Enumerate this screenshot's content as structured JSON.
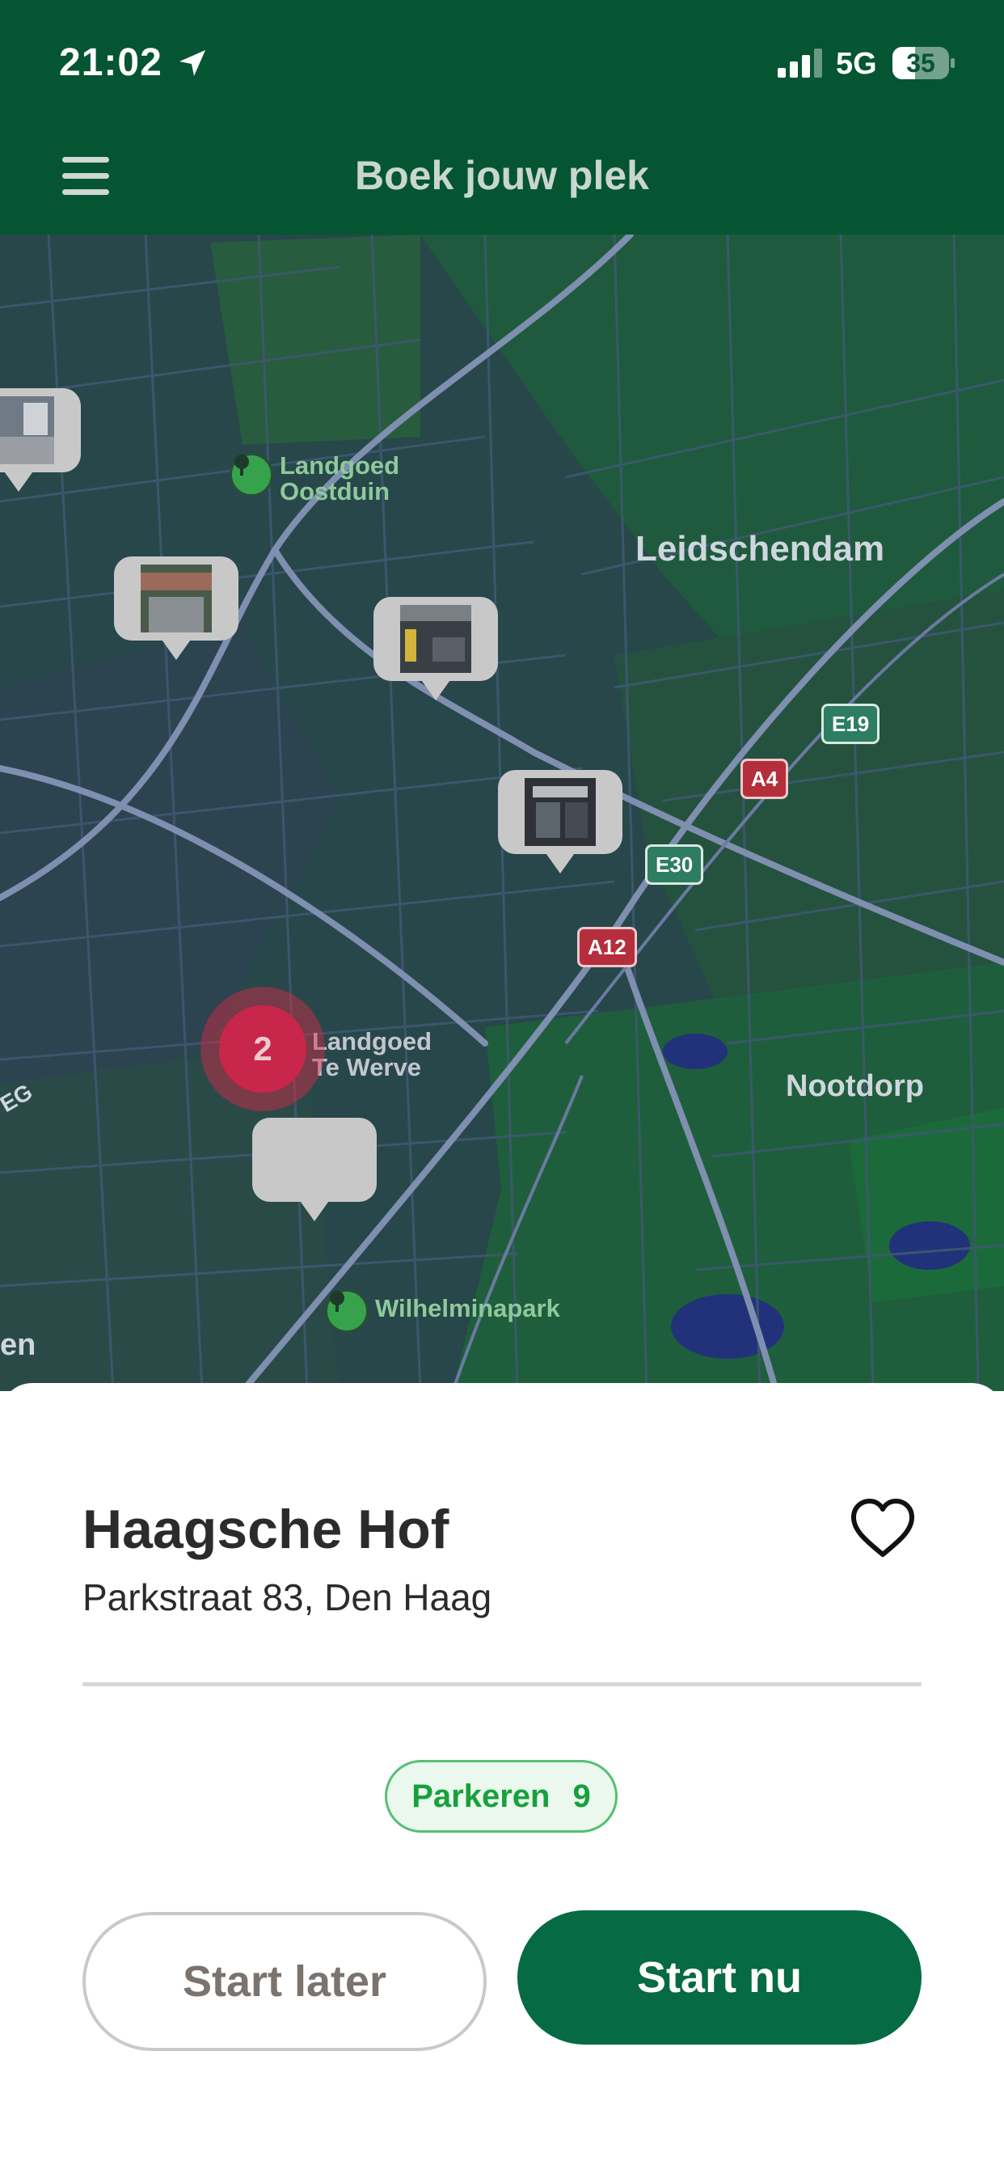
{
  "status_bar": {
    "time": "21:02",
    "network": "5G",
    "battery": "35"
  },
  "header": {
    "title": "Boek jouw plek",
    "menu_icon": "hamburger-icon"
  },
  "map": {
    "city_labels": [
      "Leidschendam",
      "Nootdorp"
    ],
    "edge_labels": [
      "EG",
      "en"
    ],
    "poi": [
      {
        "name_line1": "Landgoed",
        "name_line2": "Oostduin",
        "icon": "park-tree-icon"
      },
      {
        "name_line1": "Landgoed",
        "name_line2": "Te Werve",
        "icon": "landmark-icon"
      },
      {
        "name_line1": "Wilhelminapark",
        "name_line2": "",
        "icon": "park-tree-icon"
      }
    ],
    "road_signs": [
      "E19",
      "A4",
      "E30",
      "A12"
    ],
    "cluster_count": "2"
  },
  "place": {
    "name": "Haagsche Hof",
    "address": "Parkstraat 83, Den Haag",
    "chip_label": "Parkeren",
    "chip_count": "9"
  },
  "actions": {
    "later_label": "Start later",
    "now_label": "Start nu"
  },
  "colors": {
    "header": "#055533",
    "primary_button": "#066a44",
    "chip_green": "#18a03c",
    "cluster": "#c8264a"
  }
}
